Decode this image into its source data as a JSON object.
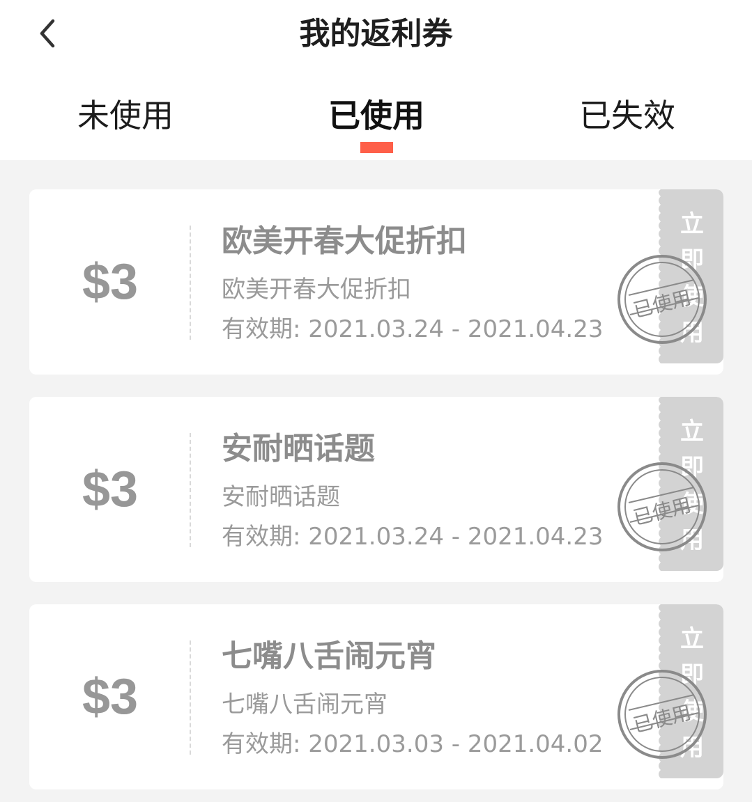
{
  "header": {
    "title": "我的返利券",
    "back_icon": "chevron-left-icon"
  },
  "tabs": [
    {
      "label": "未使用",
      "active": false
    },
    {
      "label": "已使用",
      "active": true
    },
    {
      "label": "已失效",
      "active": false
    }
  ],
  "colors": {
    "accent": "#fe5f49",
    "background": "#f3f3f3",
    "stub": "#d3d3d3",
    "muted_text": "#9a9a9a"
  },
  "coupons": [
    {
      "amount": "$3",
      "title": "欧美开春大促折扣",
      "subtitle": "欧美开春大促折扣",
      "validity_label": "有效期:",
      "validity": "2021.03.24 - 2021.04.23",
      "action": "立即使用",
      "stamp": "已使用"
    },
    {
      "amount": "$3",
      "title": "安耐晒话题",
      "subtitle": "安耐晒话题",
      "validity_label": "有效期:",
      "validity": "2021.03.24 - 2021.04.23",
      "action": "立即使用",
      "stamp": "已使用"
    },
    {
      "amount": "$3",
      "title": "七嘴八舌闹元宵",
      "subtitle": "七嘴八舌闹元宵",
      "validity_label": "有效期:",
      "validity": "2021.03.03 - 2021.04.02",
      "action": "立即使用",
      "stamp": "已使用"
    }
  ]
}
